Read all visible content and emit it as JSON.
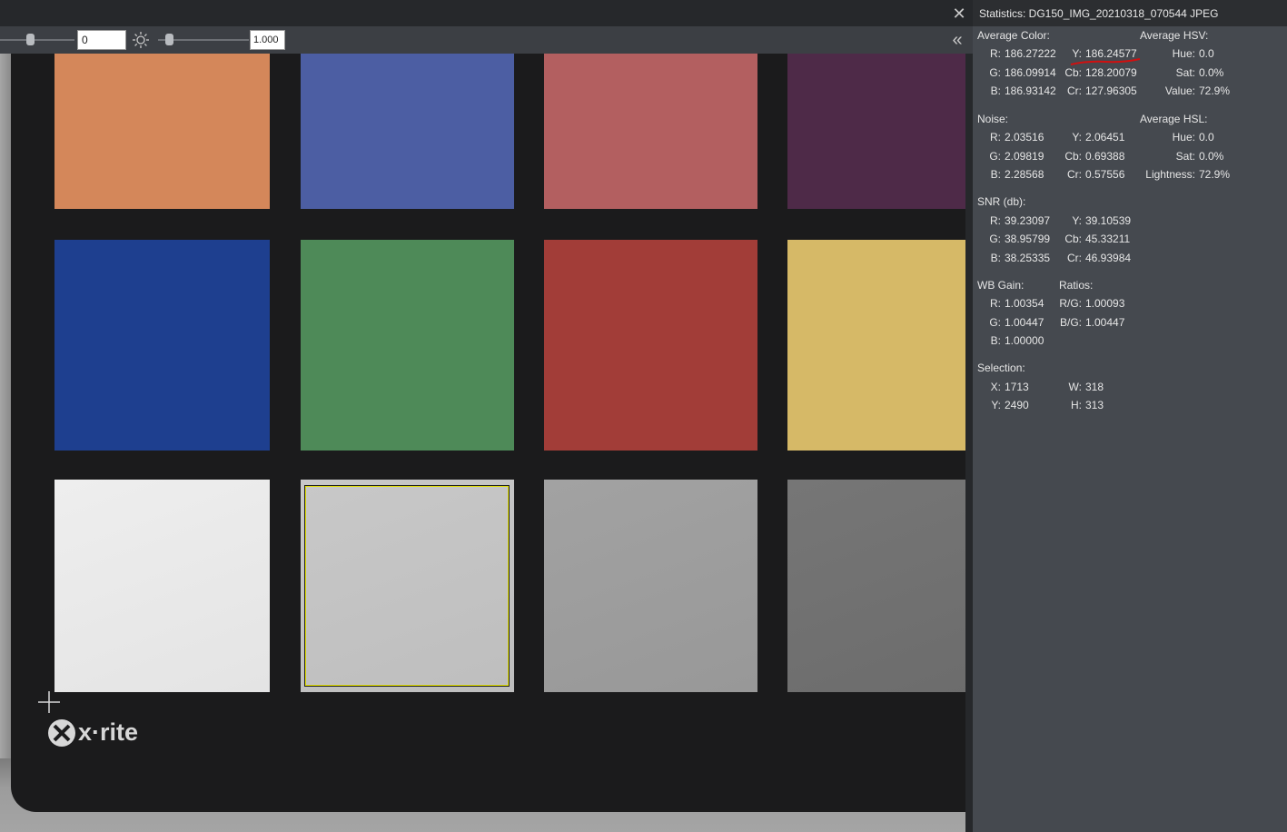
{
  "toolbar": {
    "offset_value": "0",
    "gamma_value": "1.000"
  },
  "icons": {
    "close": "close-icon",
    "brightness": "sun-icon",
    "collapse": "double-chevron-left-icon"
  },
  "chart": {
    "logo_text": "x·rite",
    "patch_colors": [
      [
        "#d4875a",
        "#4c5ea3",
        "#b35f60",
        "#4e2a48"
      ],
      [
        "#1e3f8f",
        "#4e8a58",
        "#a23d38",
        "#d6b967"
      ],
      [
        "#eeeeee",
        "#c8c8c8",
        "#a2a2a2",
        "#767676"
      ]
    ]
  },
  "stats": {
    "title": "Statistics: DG150_IMG_20210318_070544 JPEG",
    "average_color": {
      "heading": "Average Color:",
      "r_label": "R:",
      "r": "186.27222",
      "g_label": "G:",
      "g": "186.09914",
      "b_label": "B:",
      "b": "186.93142",
      "y_label": "Y:",
      "y": "186.24577",
      "cb_label": "Cb:",
      "cb": "128.20079",
      "cr_label": "Cr:",
      "cr": "127.96305"
    },
    "average_hsv": {
      "heading": "Average HSV:",
      "hue_label": "Hue:",
      "hue": "0.0",
      "sat_label": "Sat:",
      "sat": "0.0%",
      "value_label": "Value:",
      "value": "72.9%"
    },
    "noise": {
      "heading": "Noise:",
      "r_label": "R:",
      "r": "2.03516",
      "g_label": "G:",
      "g": "2.09819",
      "b_label": "B:",
      "b": "2.28568",
      "y_label": "Y:",
      "y": "2.06451",
      "cb_label": "Cb:",
      "cb": "0.69388",
      "cr_label": "Cr:",
      "cr": "0.57556"
    },
    "average_hsl": {
      "heading": "Average HSL:",
      "hue_label": "Hue:",
      "hue": "0.0",
      "sat_label": "Sat:",
      "sat": "0.0%",
      "lightness_label": "Lightness:",
      "lightness": "72.9%"
    },
    "snr": {
      "heading": "SNR (db):",
      "r_label": "R:",
      "r": "39.23097",
      "g_label": "G:",
      "g": "38.95799",
      "b_label": "B:",
      "b": "38.25335",
      "y_label": "Y:",
      "y": "39.10539",
      "cb_label": "Cb:",
      "cb": "45.33211",
      "cr_label": "Cr:",
      "cr": "46.93984"
    },
    "wb_gain": {
      "heading": "WB Gain:",
      "r_label": "R:",
      "r": "1.00354",
      "g_label": "G:",
      "g": "1.00447",
      "b_label": "B:",
      "b": "1.00000"
    },
    "ratios": {
      "heading": "Ratios:",
      "rg_label": "R/G:",
      "rg": "1.00093",
      "bg_label": "B/G:",
      "bg": "1.00447"
    },
    "selection": {
      "heading": "Selection:",
      "x_label": "X:",
      "x": "1713",
      "y_label": "Y:",
      "y": "2490",
      "w_label": "W:",
      "w": "318",
      "h_label": "H:",
      "h": "313"
    }
  },
  "colors": {
    "annotation_underline": "#d01010",
    "selection_border": "#e3e000"
  }
}
